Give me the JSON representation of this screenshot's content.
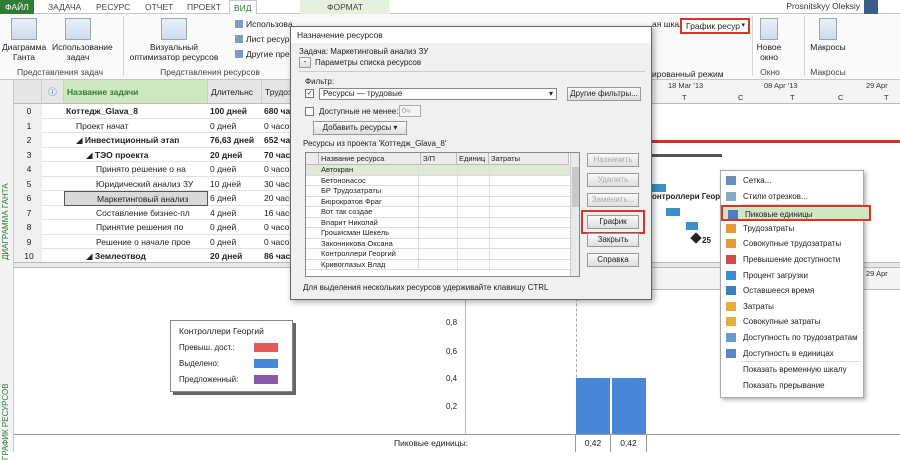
{
  "tabs": [
    "ФАЙЛ",
    "ЗАДАЧА",
    "РЕСУРС",
    "ОТЧЕТ",
    "ПРОЕКТ",
    "ВИД",
    "ФОРМАТ"
  ],
  "user": "Prosnitskyy Oleksiy",
  "ribbon": {
    "gantt_btn": "Диаграмма Ганта",
    "usage_btn": "Использование задач",
    "task_views_label": "Представления задач",
    "visual_optimizer": "Визуальный оптимизатор ресурсов",
    "use_item": "Использова",
    "res_sheet": "Лист ресур",
    "other_views": "Другие пре",
    "res_views_label": "Представления ресурсов",
    "scale_hint": "ая шкала",
    "graph_dropdown": "График ресур",
    "combined_mode": "ированный режим",
    "new_window": "Новое окно",
    "window_label": "Окно",
    "macros": "Макросы",
    "macros_label": "Макросы"
  },
  "table": {
    "headers": [
      "",
      "",
      "Название задачи",
      "Длительнс",
      "Трудоз"
    ],
    "rows": [
      {
        "id": "0",
        "name": "Коттедж_Glava_8",
        "dur": "100 дней",
        "work": "680 ча",
        "bold": true,
        "indent": 0
      },
      {
        "id": "1",
        "name": "Проект начат",
        "dur": "0 дней",
        "work": "0 часо",
        "bold": false,
        "indent": 1
      },
      {
        "id": "2",
        "name": "◢ Инвестиционный этап",
        "dur": "76,63 дней",
        "work": "652 час",
        "bold": true,
        "indent": 1
      },
      {
        "id": "3",
        "name": "◢ ТЭО проекта",
        "dur": "20 дней",
        "work": "70 час",
        "bold": true,
        "indent": 2
      },
      {
        "id": "4",
        "name": "Принято решение о на",
        "dur": "0 дней",
        "work": "0 часо",
        "bold": false,
        "indent": 3
      },
      {
        "id": "5",
        "name": "Юридический анализ ЗУ",
        "dur": "10 дней",
        "work": "30 часо",
        "bold": false,
        "indent": 3
      },
      {
        "id": "6",
        "name": "Маркетинговый анализ",
        "dur": "6 дней",
        "work": "20 часо",
        "bold": false,
        "indent": 3
      },
      {
        "id": "7",
        "name": "Составление бизнес-пл",
        "dur": "4 дней",
        "work": "16 часо",
        "bold": false,
        "indent": 3
      },
      {
        "id": "8",
        "name": "Принятие решения по",
        "dur": "0 дней",
        "work": "0 часо",
        "bold": false,
        "indent": 3
      },
      {
        "id": "9",
        "name": "Решение о начале прое",
        "dur": "0 дней",
        "work": "0 часо",
        "bold": false,
        "indent": 3
      },
      {
        "id": "10",
        "name": "◢ Землеотвод",
        "dur": "20 дней",
        "work": "86 часо",
        "bold": true,
        "indent": 2
      }
    ]
  },
  "left_labels": {
    "gantt": "ДИАГРАММА ГАНТА",
    "resources": "ГРАФИК РЕСУРСОВ"
  },
  "timescale": {
    "top": [
      "18 Mar '13",
      "08 Apr '13",
      "29 Apr"
    ],
    "days": [
      "T",
      "C",
      "T",
      "C",
      "T"
    ]
  },
  "gantt_bar_label": "онтроллери Георг",
  "gantt_num": "25",
  "legend": {
    "title": "Контроллери Георгий",
    "over": "Превыш. дост.:",
    "alloc": "Выделено:",
    "proposed": "Предложенный:"
  },
  "graph": {
    "y_ticks": [
      "0,8",
      "0,6",
      "0,4",
      "0,2"
    ],
    "row_label": "Пиковые единицы:",
    "values": [
      "0,42",
      "0,42"
    ],
    "values_num": [
      0.42,
      0.42
    ]
  },
  "dialog": {
    "title": "Назначение ресурсов",
    "task": "Задача: Маркетинговый анализ ЗУ",
    "params": "Параметры списка ресурсов",
    "filter_label": "Фильтр:",
    "filter_value": "Ресурсы — трудовые",
    "more_filters": "Другие фильтры...",
    "available": "Доступные не менее:",
    "hours": "0ч",
    "add_res": "Добавить ресурсы",
    "list_label": "Ресурсы из проекта 'Коттедж_Glava_8'",
    "cols": [
      "Название ресурса",
      "З/П",
      "Единиц",
      "Затраты"
    ],
    "resources": [
      "Автокран",
      "Бетононасос",
      "БР Трудозатраты",
      "Бюрократов Фраг",
      "Вот так создае",
      "Впарит Николай",
      "Грошисман Шекель",
      "Законникова Оксана",
      "Контроллери Георгий",
      "Кривоглазых Влад"
    ],
    "buttons": {
      "assign": "Назначить",
      "remove": "Удалить",
      "replace": "Заменить...",
      "graph": "График",
      "close": "Закрыть",
      "help": "Справка"
    },
    "hint": "Для выделения нескольких ресурсов удерживайте клавишу CTRL"
  },
  "menu": {
    "items": [
      "Сетка...",
      "Стили отрезков...",
      "Пиковые единицы",
      "Трудозатраты",
      "Совокупные трудозатраты",
      "Превышение доступности",
      "Процент загрузки",
      "Оставшееся время",
      "Затраты",
      "Совокупные затраты",
      "Доступность по трудозатратам",
      "Доступность в единицах",
      "Показать временную шкалу",
      "Показать прерывание"
    ]
  },
  "colors": {
    "accent": "#2e7d32",
    "highlight_red": "#d32f2f",
    "over": "#e05a5a",
    "alloc": "#4a86d8",
    "proposed": "#8a5aa8"
  }
}
